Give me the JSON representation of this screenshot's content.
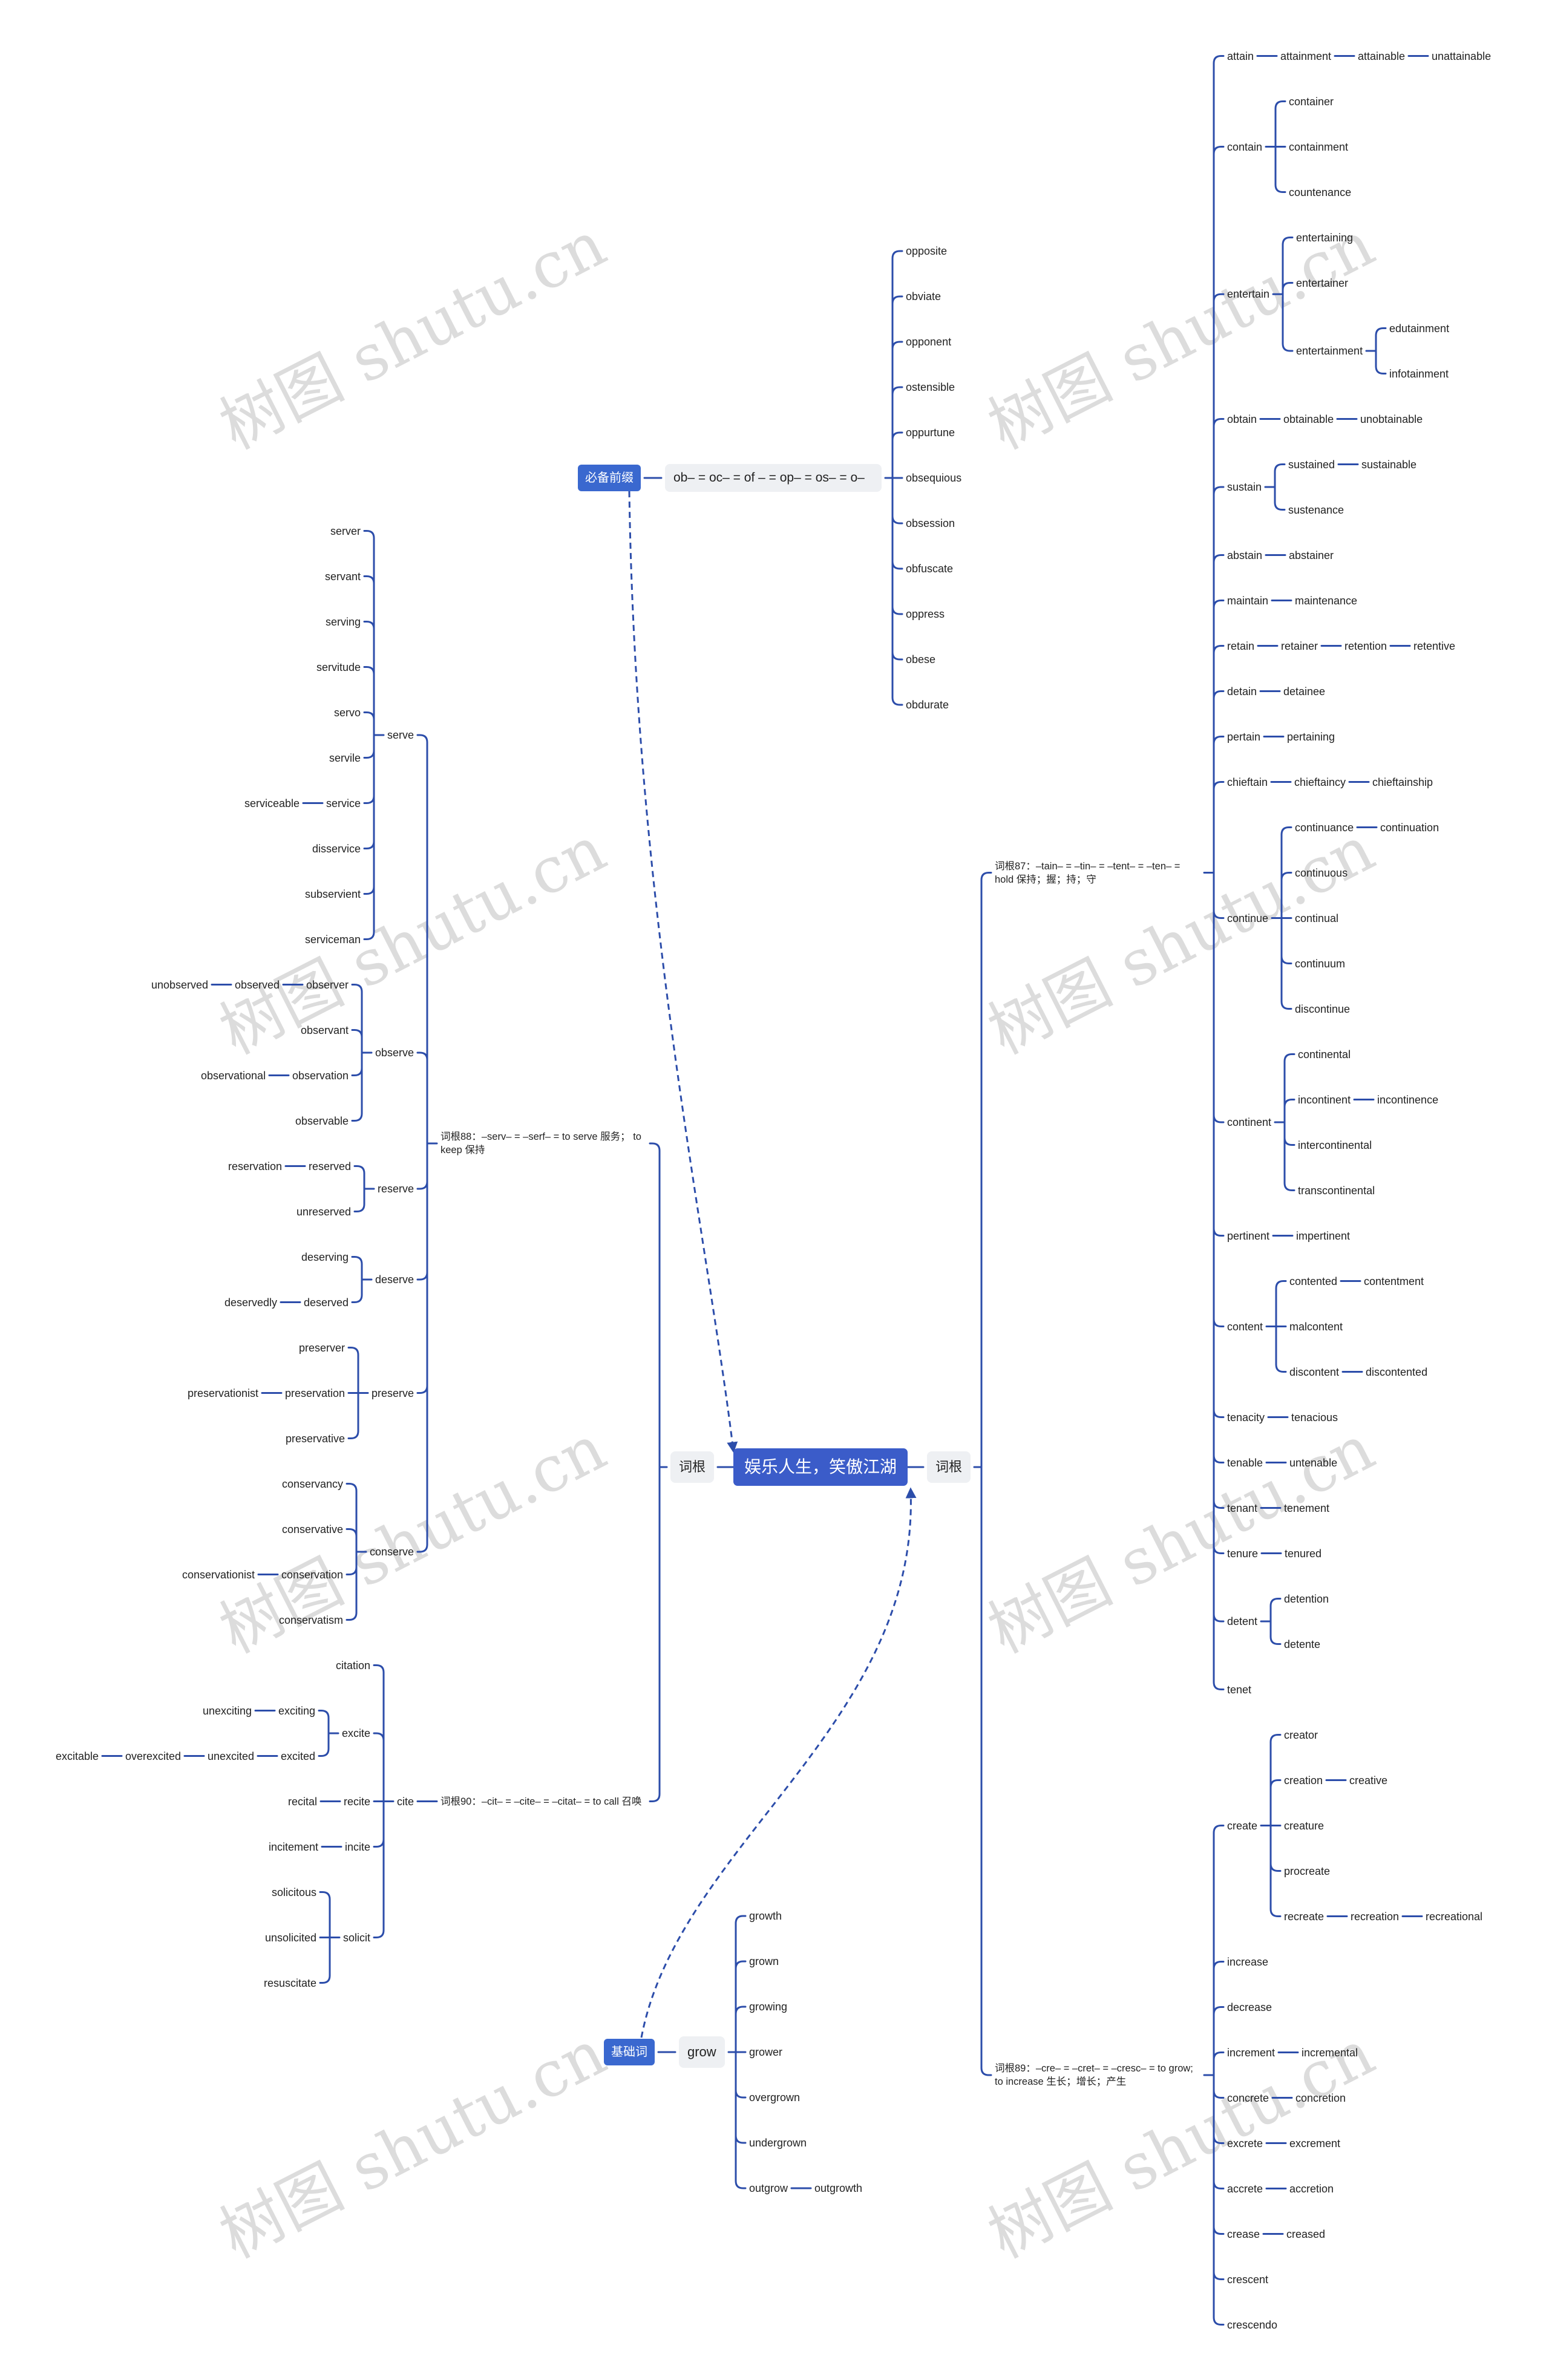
{
  "root": {
    "label": "娱乐人生，笑傲江湖"
  },
  "watermark": "树图 shutu.cn",
  "colors": {
    "root": "#3B5CC9",
    "blue_box": "#3A68CF",
    "gray_box": "#EEF0F3",
    "line": "#2C4DAA"
  },
  "prefix_branch": {
    "label": "必备前缀",
    "children": [
      {
        "label": "ob– = oc–  = of – = op– = os– = o–",
        "children": [
          {
            "label": "opposite"
          },
          {
            "label": "obviate"
          },
          {
            "label": "opponent"
          },
          {
            "label": "ostensible"
          },
          {
            "label": "oppurtune"
          },
          {
            "label": "obsequious"
          },
          {
            "label": "obsession"
          },
          {
            "label": "obfuscate"
          },
          {
            "label": "oppress"
          },
          {
            "label": "obese"
          },
          {
            "label": "obdurate"
          }
        ]
      }
    ]
  },
  "right_branch": {
    "label": "词根",
    "children": [
      {
        "label": "词根87：–tain– = –tin– = –tent– = –ten– = hold 保持；握；持；守",
        "children": [
          {
            "label": "attain",
            "children": [
              {
                "label": "attainment",
                "children": [
                  {
                    "label": "attainable",
                    "children": [
                      {
                        "label": "unattainable"
                      }
                    ]
                  }
                ]
              }
            ]
          },
          {
            "label": "contain",
            "children": [
              {
                "label": "container"
              },
              {
                "label": "containment"
              },
              {
                "label": "countenance"
              }
            ]
          },
          {
            "label": "entertain",
            "children": [
              {
                "label": "entertaining"
              },
              {
                "label": "entertainer"
              },
              {
                "label": "entertainment",
                "children": [
                  {
                    "label": "edutainment"
                  },
                  {
                    "label": "infotainment"
                  }
                ]
              }
            ]
          },
          {
            "label": "obtain",
            "children": [
              {
                "label": "obtainable",
                "children": [
                  {
                    "label": "unobtainable"
                  }
                ]
              }
            ]
          },
          {
            "label": "sustain",
            "children": [
              {
                "label": "sustained",
                "children": [
                  {
                    "label": "sustainable"
                  }
                ]
              },
              {
                "label": "sustenance"
              }
            ]
          },
          {
            "label": "abstain",
            "children": [
              {
                "label": "abstainer"
              }
            ]
          },
          {
            "label": "maintain",
            "children": [
              {
                "label": "maintenance"
              }
            ]
          },
          {
            "label": "retain",
            "children": [
              {
                "label": "retainer",
                "children": [
                  {
                    "label": "retention",
                    "children": [
                      {
                        "label": "retentive"
                      }
                    ]
                  }
                ]
              }
            ]
          },
          {
            "label": "detain",
            "children": [
              {
                "label": "detainee"
              }
            ]
          },
          {
            "label": "pertain",
            "children": [
              {
                "label": "pertaining"
              }
            ]
          },
          {
            "label": "chieftain",
            "children": [
              {
                "label": "chieftaincy",
                "children": [
                  {
                    "label": "chieftainship"
                  }
                ]
              }
            ]
          },
          {
            "label": "continue",
            "children": [
              {
                "label": "continuance",
                "children": [
                  {
                    "label": "continuation"
                  }
                ]
              },
              {
                "label": "continuous"
              },
              {
                "label": "continual"
              },
              {
                "label": "continuum"
              },
              {
                "label": "discontinue"
              }
            ]
          },
          {
            "label": "continent",
            "children": [
              {
                "label": "continental"
              },
              {
                "label": "incontinent",
                "children": [
                  {
                    "label": "incontinence"
                  }
                ]
              },
              {
                "label": "intercontinental"
              },
              {
                "label": "transcontinental"
              }
            ]
          },
          {
            "label": "pertinent",
            "children": [
              {
                "label": "impertinent"
              }
            ]
          },
          {
            "label": "content",
            "children": [
              {
                "label": "contented",
                "children": [
                  {
                    "label": "contentment"
                  }
                ]
              },
              {
                "label": "malcontent"
              },
              {
                "label": "discontent",
                "children": [
                  {
                    "label": "discontented"
                  }
                ]
              }
            ]
          },
          {
            "label": "tenacity",
            "children": [
              {
                "label": "tenacious"
              }
            ]
          },
          {
            "label": "tenable",
            "children": [
              {
                "label": "untenable"
              }
            ]
          },
          {
            "label": "tenant",
            "children": [
              {
                "label": "tenement"
              }
            ]
          },
          {
            "label": "tenure",
            "children": [
              {
                "label": "tenured"
              }
            ]
          },
          {
            "label": "detent",
            "children": [
              {
                "label": "detention"
              },
              {
                "label": "detente"
              }
            ]
          },
          {
            "label": "tenet"
          }
        ]
      },
      {
        "label": "词根89：–cre– = –cret– = –cresc– = to grow; to increase 生长；增长；产生",
        "children": [
          {
            "label": "create",
            "children": [
              {
                "label": "creator"
              },
              {
                "label": "creation",
                "children": [
                  {
                    "label": "creative"
                  }
                ]
              },
              {
                "label": "creature"
              },
              {
                "label": "procreate"
              },
              {
                "label": "recreate",
                "children": [
                  {
                    "label": "recreation",
                    "children": [
                      {
                        "label": "recreational"
                      }
                    ]
                  }
                ]
              }
            ]
          },
          {
            "label": "increase"
          },
          {
            "label": "decrease"
          },
          {
            "label": "increment",
            "children": [
              {
                "label": "incremental"
              }
            ]
          },
          {
            "label": "concrete",
            "children": [
              {
                "label": "concretion"
              }
            ]
          },
          {
            "label": "excrete",
            "children": [
              {
                "label": "excrement"
              }
            ]
          },
          {
            "label": "accrete",
            "children": [
              {
                "label": "accretion"
              }
            ]
          },
          {
            "label": "crease",
            "children": [
              {
                "label": "creased"
              }
            ]
          },
          {
            "label": "crescent"
          },
          {
            "label": "crescendo"
          }
        ]
      }
    ]
  },
  "left_branch": {
    "label": "词根",
    "children": [
      {
        "label": "词根88：–serv– = –serf– = to serve 服务； to keep 保持",
        "children": [
          {
            "label": "serve",
            "children": [
              {
                "label": "server"
              },
              {
                "label": "servant"
              },
              {
                "label": "serving"
              },
              {
                "label": "servitude"
              },
              {
                "label": "servo"
              },
              {
                "label": "servile"
              },
              {
                "label": "service",
                "children": [
                  {
                    "label": "serviceable"
                  }
                ]
              },
              {
                "label": "disservice"
              },
              {
                "label": "subservient"
              },
              {
                "label": "serviceman"
              }
            ]
          },
          {
            "label": "observe",
            "children": [
              {
                "label": "observer",
                "children": [
                  {
                    "label": "observed",
                    "children": [
                      {
                        "label": "unobserved"
                      }
                    ]
                  }
                ]
              },
              {
                "label": "observant"
              },
              {
                "label": "observation",
                "children": [
                  {
                    "label": "observational"
                  }
                ]
              },
              {
                "label": "observable"
              }
            ]
          },
          {
            "label": "reserve",
            "children": [
              {
                "label": "reserved",
                "children": [
                  {
                    "label": "reservation"
                  }
                ]
              },
              {
                "label": "unreserved"
              }
            ]
          },
          {
            "label": "deserve",
            "children": [
              {
                "label": "deserving"
              },
              {
                "label": "deserved",
                "children": [
                  {
                    "label": "deservedly"
                  }
                ]
              }
            ]
          },
          {
            "label": "preserve",
            "children": [
              {
                "label": "preserver"
              },
              {
                "label": "preservation",
                "children": [
                  {
                    "label": "preservationist"
                  }
                ]
              },
              {
                "label": "preservative"
              }
            ]
          },
          {
            "label": "conserve",
            "children": [
              {
                "label": "conservancy"
              },
              {
                "label": "conservative"
              },
              {
                "label": "conservation",
                "children": [
                  {
                    "label": "conservationist"
                  }
                ]
              },
              {
                "label": "conservatism"
              }
            ]
          }
        ]
      },
      {
        "label": "词根90：–cit– = –cite– = –citat– = to call 召唤",
        "children": [
          {
            "label": "cite",
            "children": [
              {
                "label": "citation"
              },
              {
                "label": "excite",
                "children": [
                  {
                    "label": "exciting",
                    "children": [
                      {
                        "label": "unexciting"
                      }
                    ]
                  },
                  {
                    "label": "excited",
                    "children": [
                      {
                        "label": "unexcited",
                        "children": [
                          {
                            "label": "overexcited",
                            "children": [
                              {
                                "label": "excitable"
                              }
                            ]
                          }
                        ]
                      }
                    ]
                  }
                ]
              },
              {
                "label": "recite",
                "children": [
                  {
                    "label": "recital"
                  }
                ]
              },
              {
                "label": "incite",
                "children": [
                  {
                    "label": "incitement"
                  }
                ]
              },
              {
                "label": "solicit",
                "children": [
                  {
                    "label": "solicitous"
                  },
                  {
                    "label": "unsolicited"
                  },
                  {
                    "label": "resuscitate"
                  }
                ]
              }
            ]
          }
        ]
      }
    ]
  },
  "base_branch": {
    "label": "基础词",
    "children": [
      {
        "label": "grow",
        "children": [
          {
            "label": "growth"
          },
          {
            "label": "grown"
          },
          {
            "label": "growing"
          },
          {
            "label": "grower"
          },
          {
            "label": "overgrown"
          },
          {
            "label": "undergrown"
          },
          {
            "label": "outgrow",
            "children": [
              {
                "label": "outgrowth"
              }
            ]
          }
        ]
      }
    ]
  }
}
